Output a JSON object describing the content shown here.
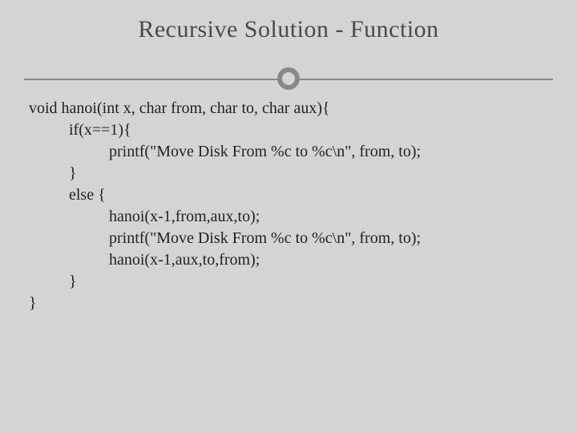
{
  "title": "Recursive Solution - Function",
  "code": "void hanoi(int x, char from, char to, char aux){\n          if(x==1){\n                    printf(\"Move Disk From %c to %c\\n\", from, to);\n          }\n          else {\n                    hanoi(x-1,from,aux,to);\n                    printf(\"Move Disk From %c to %c\\n\", from, to);\n                    hanoi(x-1,aux,to,from);\n          }\n}"
}
